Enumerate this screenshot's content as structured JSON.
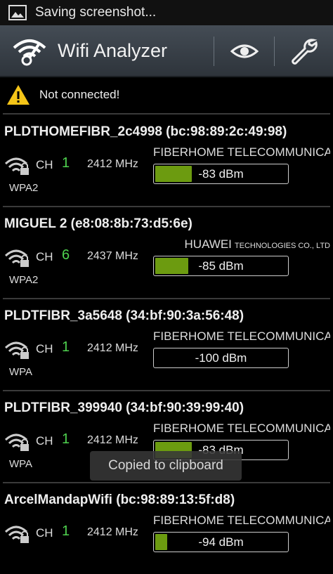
{
  "status_bar": {
    "text": "Saving screenshot..."
  },
  "action_bar": {
    "title": "Wifi Analyzer"
  },
  "notice": {
    "text": "Not connected!"
  },
  "access_points": [
    {
      "name": "PLDTHOMEFIBR_2c4998 (bc:98:89:2c:49:98)",
      "ch_label": "CH",
      "channel": "1",
      "freq": "2412 MHz",
      "vendor": "FIBERHOME TELECOMMUNICA...",
      "vendor_small": "",
      "security": "WPA2",
      "dbm": "-83 dBm",
      "signal_fraction": 0.28
    },
    {
      "name": "MIGUEL 2 (e8:08:8b:73:d5:6e)",
      "ch_label": "CH",
      "channel": "6",
      "freq": "2437 MHz",
      "vendor": "HUAWEI",
      "vendor_small": "TECHNOLOGIES CO., LTD",
      "security": "WPA2",
      "dbm": "-85 dBm",
      "signal_fraction": 0.25
    },
    {
      "name": "PLDTFIBR_3a5648 (34:bf:90:3a:56:48)",
      "ch_label": "CH",
      "channel": "1",
      "freq": "2412 MHz",
      "vendor": "FIBERHOME TELECOMMUNICA...",
      "vendor_small": "",
      "security": "WPA",
      "dbm": "-100 dBm",
      "signal_fraction": 0.0
    },
    {
      "name": "PLDTFIBR_399940 (34:bf:90:39:99:40)",
      "ch_label": "CH",
      "channel": "1",
      "freq": "2412 MHz",
      "vendor": "FIBERHOME TELECOMMUNICA...",
      "vendor_small": "",
      "security": "WPA",
      "dbm": "-83 dBm",
      "signal_fraction": 0.28
    },
    {
      "name": "ArcelMandapWifi (bc:98:89:13:5f:d8)",
      "ch_label": "CH",
      "channel": "1",
      "freq": "2412 MHz",
      "vendor": "FIBERHOME TELECOMMUNICA...",
      "vendor_small": "",
      "security": "",
      "dbm": "-94 dBm",
      "signal_fraction": 0.09
    }
  ],
  "toast": {
    "text": "Copied to clipboard"
  },
  "colors": {
    "signal_fill": "#6c9b10",
    "channel": "#4fd24f",
    "warning": "#f5c518"
  }
}
